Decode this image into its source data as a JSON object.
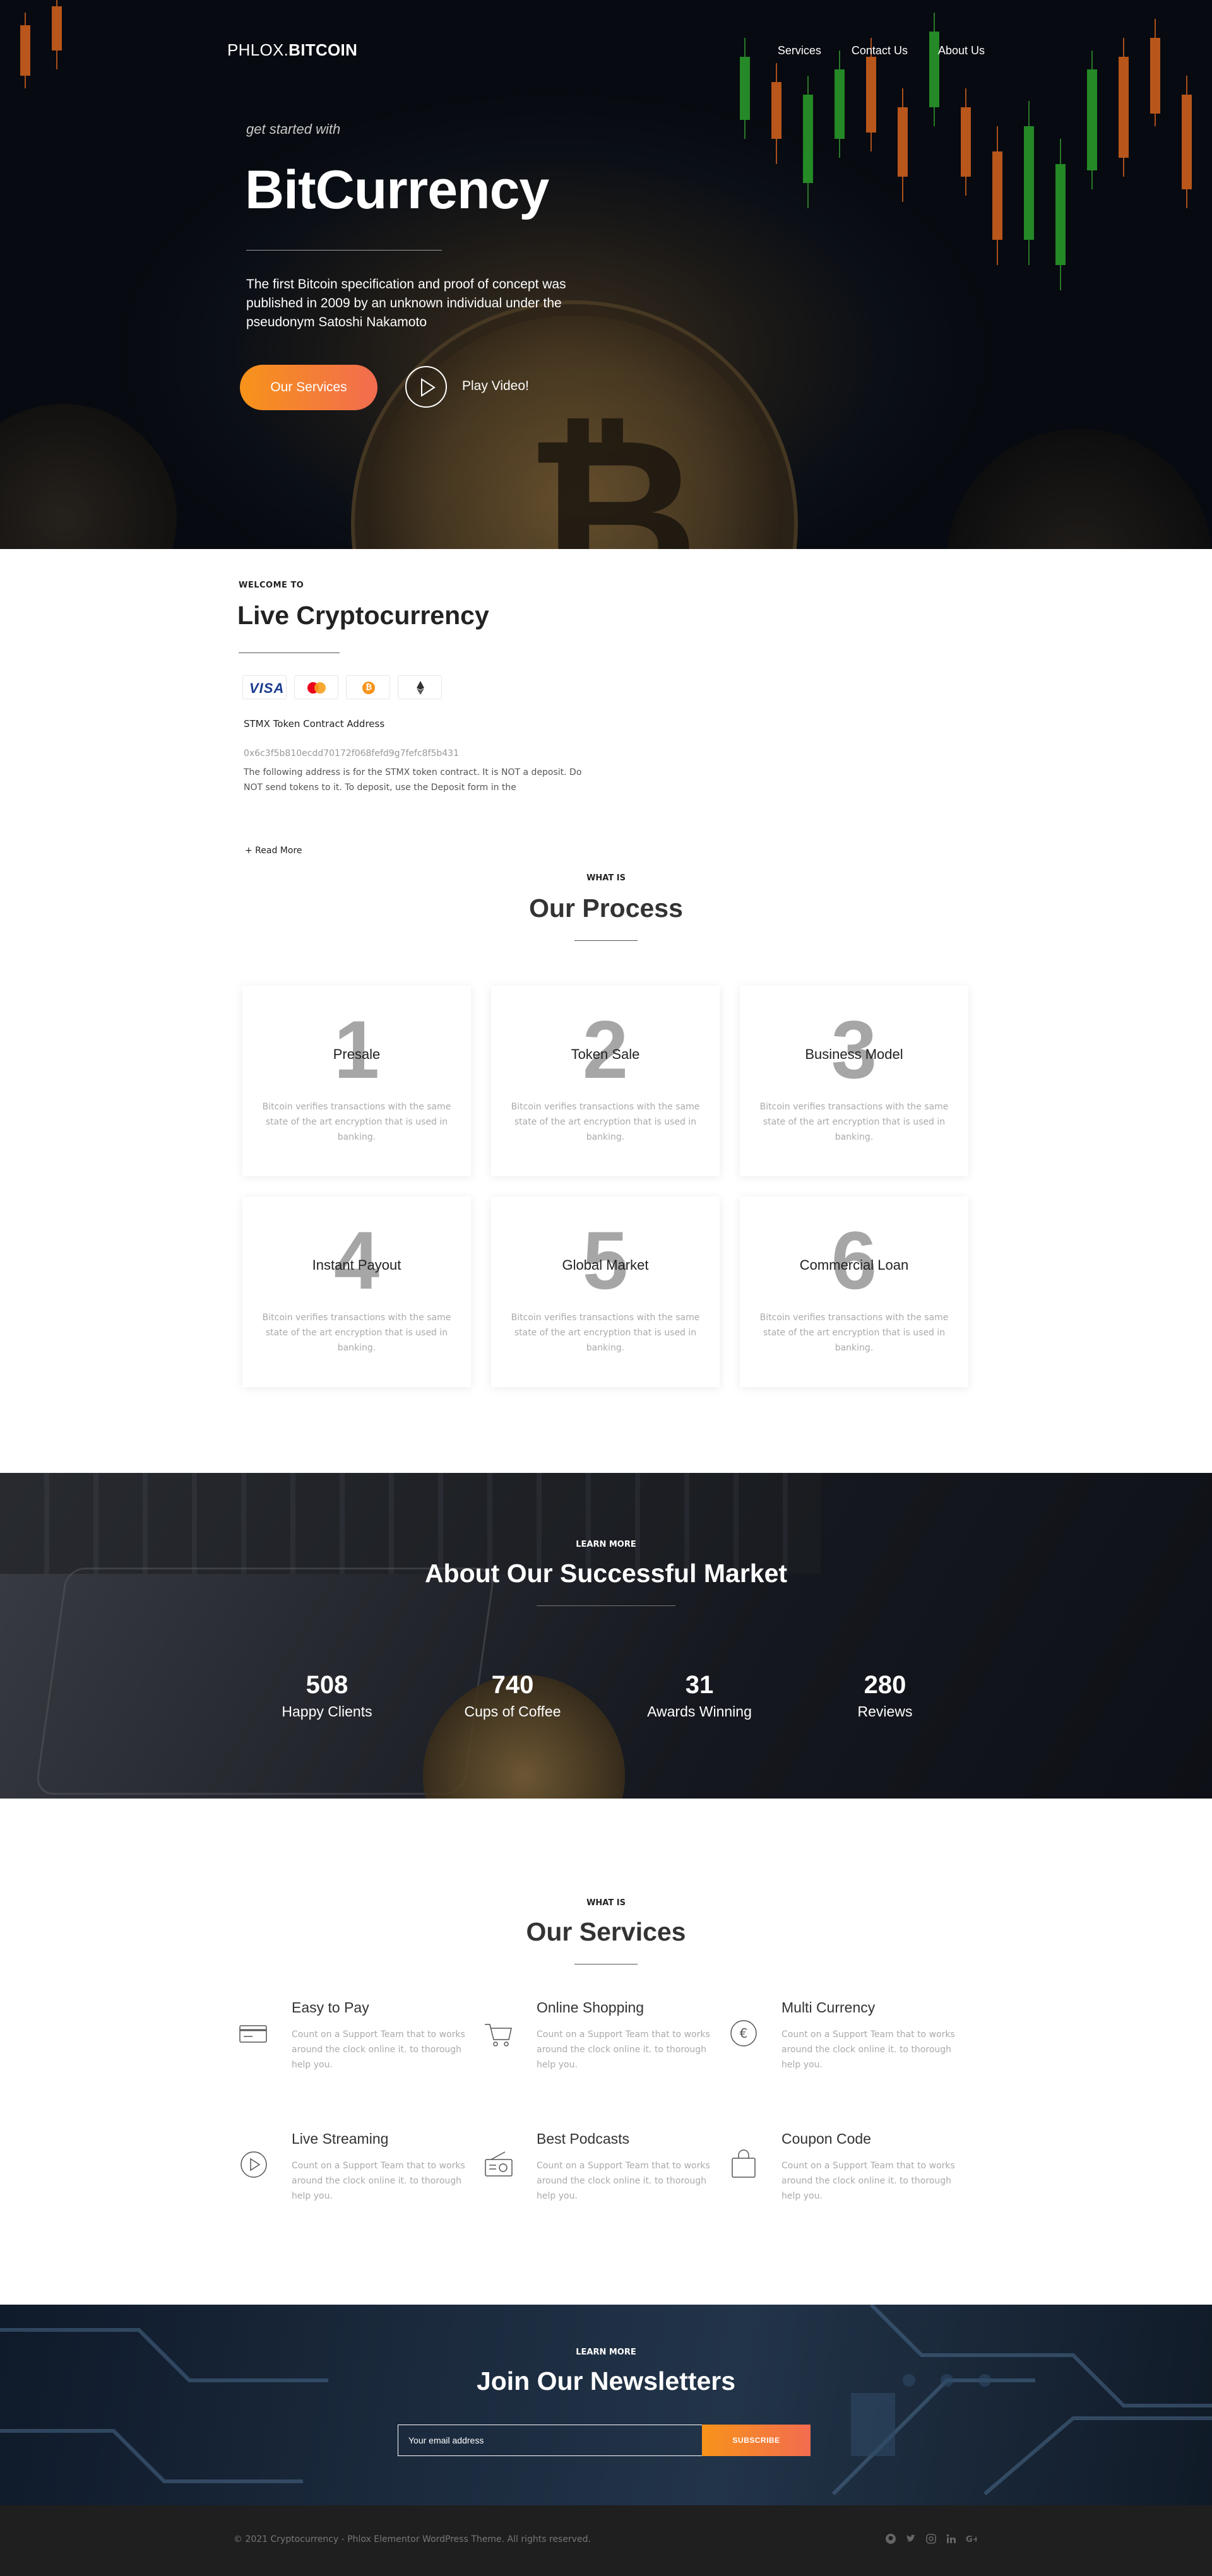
{
  "header": {
    "logo_prefix": "PHLOX.",
    "logo_bold": "BITCOIN",
    "nav": [
      "Services",
      "Contact Us",
      "About Us"
    ]
  },
  "hero": {
    "kicker": "get started with",
    "title": "BitCurrency",
    "description": "The first Bitcoin specification and proof of concept was published in 2009 by an unknown individual under the pseudonym Satoshi Nakamoto",
    "primary_button": "Our Services",
    "play_label": "Play Video!"
  },
  "welcome": {
    "kicker": "WELCOME TO",
    "title": "Live Cryptocurrency",
    "card_logos": [
      "visa",
      "mastercard",
      "bitcoin",
      "ethereum"
    ],
    "visa_text": "VISA",
    "contract_title": "STMX Token Contract Address",
    "contract_address": "0x6c3f5b810ecdd70172f068fefd9g7fefc8f5b431",
    "contract_description": "The following address is for the STMX token contract. It is NOT a deposit. Do NOT send tokens to it. To deposit, use the Deposit form in the",
    "read_more": "+ Read More"
  },
  "process": {
    "kicker": "WHAT IS",
    "title": "Our Process",
    "steps": [
      {
        "num": "1",
        "name": "Presale",
        "text": "Bitcoin verifies transactions with the same state of the art encryption that is used in banking."
      },
      {
        "num": "2",
        "name": "Token Sale",
        "text": "Bitcoin verifies transactions with the same state of the art encryption that is used in banking."
      },
      {
        "num": "3",
        "name": "Business Model",
        "text": "Bitcoin verifies transactions with the same state of the art encryption that is used in banking."
      },
      {
        "num": "4",
        "name": "Instant Payout",
        "text": "Bitcoin verifies transactions with the same state of the art encryption that is used in banking."
      },
      {
        "num": "5",
        "name": "Global Market",
        "text": "Bitcoin verifies transactions with the same state of the art encryption that is used in banking."
      },
      {
        "num": "6",
        "name": "Commercial Loan",
        "text": "Bitcoin verifies transactions with the same state of the art encryption that is used in banking."
      }
    ]
  },
  "stats": {
    "kicker": "LEARN MORE",
    "title": "About Our Successful Market",
    "items": [
      {
        "value": "508",
        "label": "Happy Clients"
      },
      {
        "value": "740",
        "label": "Cups of Coffee"
      },
      {
        "value": "31",
        "label": "Awards Winning"
      },
      {
        "value": "280",
        "label": "Reviews"
      }
    ]
  },
  "services": {
    "kicker": "WHAT IS",
    "title": "Our Services",
    "items": [
      {
        "icon": "credit-card-icon",
        "title": "Easy to Pay",
        "text": "Count on a Support Team that to works around the clock online it. to thorough help you."
      },
      {
        "icon": "shopping-cart-icon",
        "title": "Online Shopping",
        "text": "Count on a Support Team that to works around the clock online it. to thorough help you."
      },
      {
        "icon": "euro-icon",
        "title": "Multi Currency",
        "text": "Count on a Support Team that to works around the clock online it. to thorough help you."
      },
      {
        "icon": "play-circle-icon",
        "title": "Live Streaming",
        "text": "Count on a Support Team that to works around the clock online it. to thorough help you."
      },
      {
        "icon": "radio-icon",
        "title": "Best Podcasts",
        "text": "Count on a Support Team that to works around the clock online it. to thorough help you."
      },
      {
        "icon": "shopping-bag-icon",
        "title": "Coupon Code",
        "text": "Count on a Support Team that to works around the clock online it. to thorough help you."
      }
    ]
  },
  "newsletter": {
    "kicker": "LEARN MORE",
    "title": "Join Our Newsletters",
    "placeholder": "Your email address",
    "button": "SUBSCRIBE"
  },
  "footer": {
    "copyright": "© 2021 Cryptocurrency - Phlox Elementor WordPress Theme. All rights reserved.",
    "social_icons": [
      "github-icon",
      "twitter-icon",
      "instagram-icon",
      "linkedin-icon",
      "google-plus-icon"
    ]
  },
  "colors": {
    "accent_start": "#f7931a",
    "accent_end": "#f26c4f",
    "hero_dark": "#0b0f16",
    "footer_bg": "#1f1f1f"
  }
}
